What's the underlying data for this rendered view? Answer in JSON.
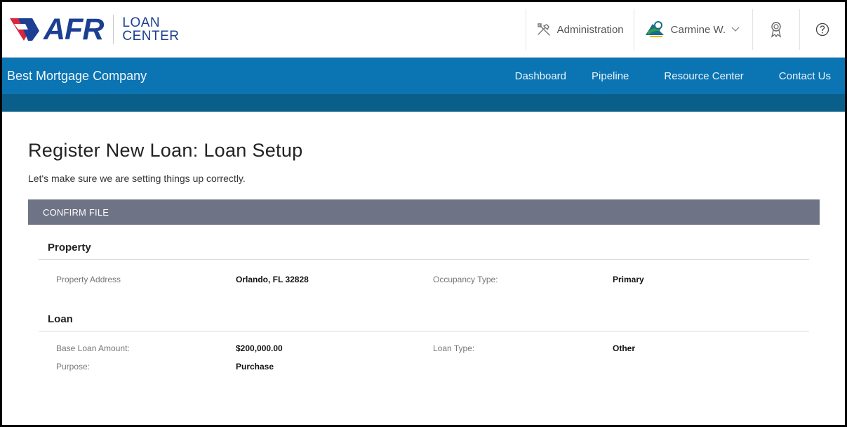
{
  "brand": {
    "logo_text": "AFR",
    "sub_line1": "LOAN",
    "sub_line2": "CENTER"
  },
  "header": {
    "admin_label": "Administration",
    "user_name": "Carmine W."
  },
  "nav": {
    "company": "Best Mortgage Company",
    "links": [
      "Dashboard",
      "Pipeline",
      "Resource Center",
      "Contact Us"
    ]
  },
  "page": {
    "title": "Register New Loan: Loan Setup",
    "subtitle": "Let's make sure we are setting things up correctly.",
    "section": "CONFIRM FILE"
  },
  "property": {
    "heading": "Property",
    "address_label": "Property Address",
    "address_value": "Orlando, FL 32828",
    "occupancy_label": "Occupancy Type:",
    "occupancy_value": "Primary"
  },
  "loan": {
    "heading": "Loan",
    "amount_label": "Base Loan Amount:",
    "amount_value": "$200,000.00",
    "type_label": "Loan Type:",
    "type_value": "Other",
    "purpose_label": "Purpose:",
    "purpose_value": "Purchase"
  },
  "colors": {
    "nav_blue": "#0b74b3",
    "subbar": "#0a5f8a",
    "section_bar": "#6e7385",
    "logo_blue": "#1c3f93",
    "logo_red": "#d7263d"
  },
  "icons": [
    "afr-logo-icon",
    "tools-icon",
    "user-avatar-icon",
    "chevron-down-icon",
    "award-icon",
    "help-icon"
  ]
}
